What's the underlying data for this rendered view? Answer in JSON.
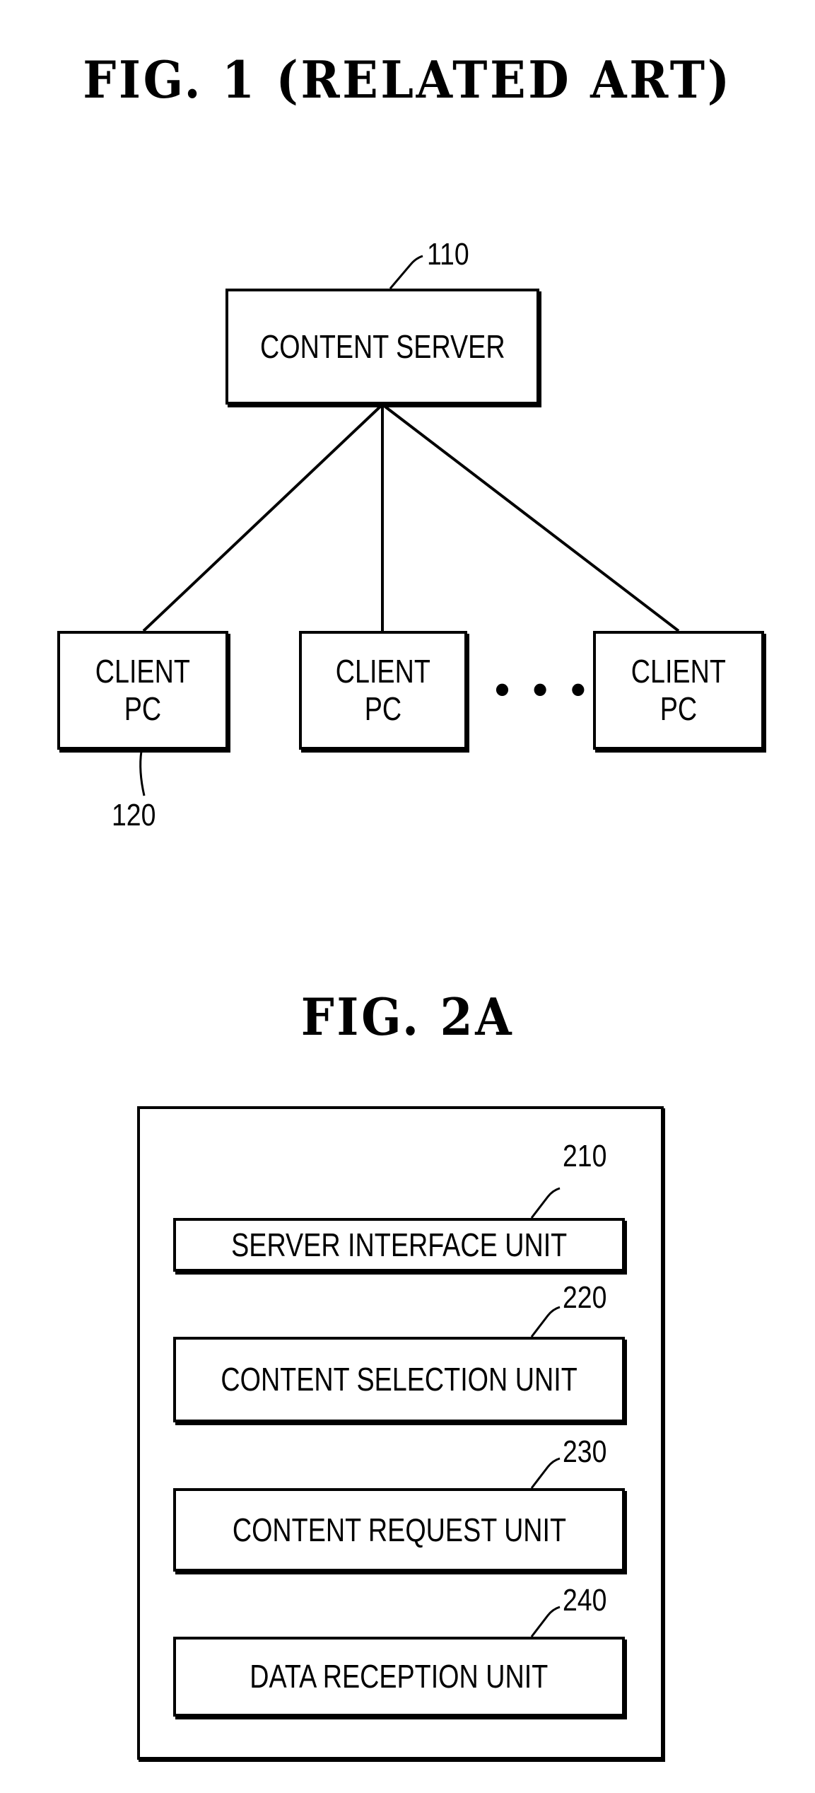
{
  "figure1": {
    "title": "FIG. 1 (RELATED ART)",
    "server": {
      "label": "CONTENT SERVER",
      "ref": "110"
    },
    "clients": [
      {
        "label_line1": "CLIENT",
        "label_line2": "PC"
      },
      {
        "label_line1": "CLIENT",
        "label_line2": "PC"
      },
      {
        "label_line1": "CLIENT",
        "label_line2": "PC"
      }
    ],
    "ellipsis": "• • •",
    "client_ref": "120"
  },
  "figure2a": {
    "title": "FIG. 2A",
    "units": [
      {
        "label": "SERVER INTERFACE UNIT",
        "ref": "210"
      },
      {
        "label": "CONTENT SELECTION UNIT",
        "ref": "220"
      },
      {
        "label": "CONTENT REQUEST UNIT",
        "ref": "230"
      },
      {
        "label": "DATA RECEPTION UNIT",
        "ref": "240"
      }
    ]
  }
}
